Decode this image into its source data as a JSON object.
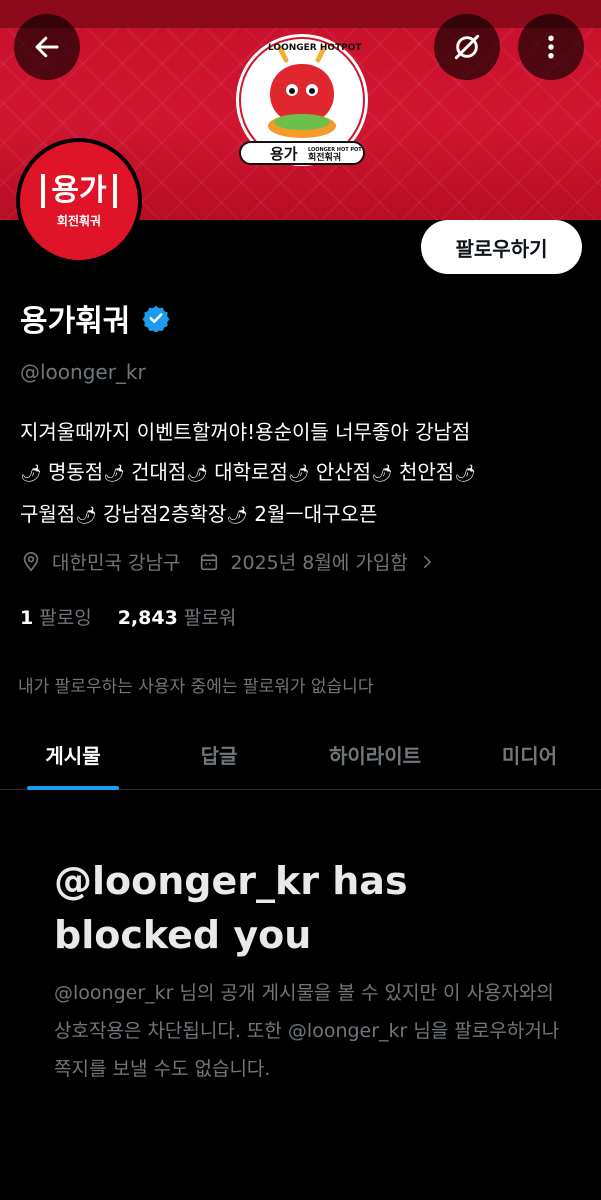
{
  "banner": {
    "logo_top_text": "LOONGER HOTPOT",
    "logo_main_text": "용가",
    "logo_sub_text": "회전훠궈",
    "logo_small_text": "LOONGER HOT POT"
  },
  "header": {
    "back_icon": "arrow-left-icon",
    "translate_icon": "translate-off-icon",
    "more_icon": "more-vertical-icon"
  },
  "avatar": {
    "main_text": "용가",
    "sub_text": "회전훠궈"
  },
  "follow_button": {
    "label": "팔로우하기"
  },
  "profile": {
    "display_name": "용가훠궈",
    "handle": "@loonger_kr",
    "bio_parts": [
      "지겨울때까지 이벤트할꺼야!용순이들 너무좋아 강남점",
      "명동점",
      "건대점",
      "대학로점",
      "안산점",
      "천안점",
      "구월점",
      "강남점2층확장",
      "2월ㅡ대구오픈"
    ],
    "location": "대한민국 강남구",
    "joined": "2025년 8월에 가입함",
    "following_count": "1",
    "following_label": "팔로잉",
    "followers_count": "2,843",
    "followers_label": "팔로워",
    "mutual_note": "내가 팔로우하는 사용자 중에는 팔로워가 없습니다"
  },
  "tabs": [
    {
      "label": "게시물",
      "active": true
    },
    {
      "label": "답글",
      "active": false
    },
    {
      "label": "하이라이트",
      "active": false
    },
    {
      "label": "미디어",
      "active": false
    }
  ],
  "blocked": {
    "title": "@loonger_kr has blocked you",
    "description": "@loonger_kr 님의 공개 게시물을 볼 수 있지만 이 사용자와의 상호작용은 차단됩니다. 또한 @loonger_kr 님을 팔로우하거나 쪽지를 보낼 수도 없습니다."
  },
  "colors": {
    "banner_red": "#d01530",
    "verified_blue": "#1d9bf0",
    "tab_underline": "#1d9bf0",
    "muted_text": "#71767b"
  }
}
